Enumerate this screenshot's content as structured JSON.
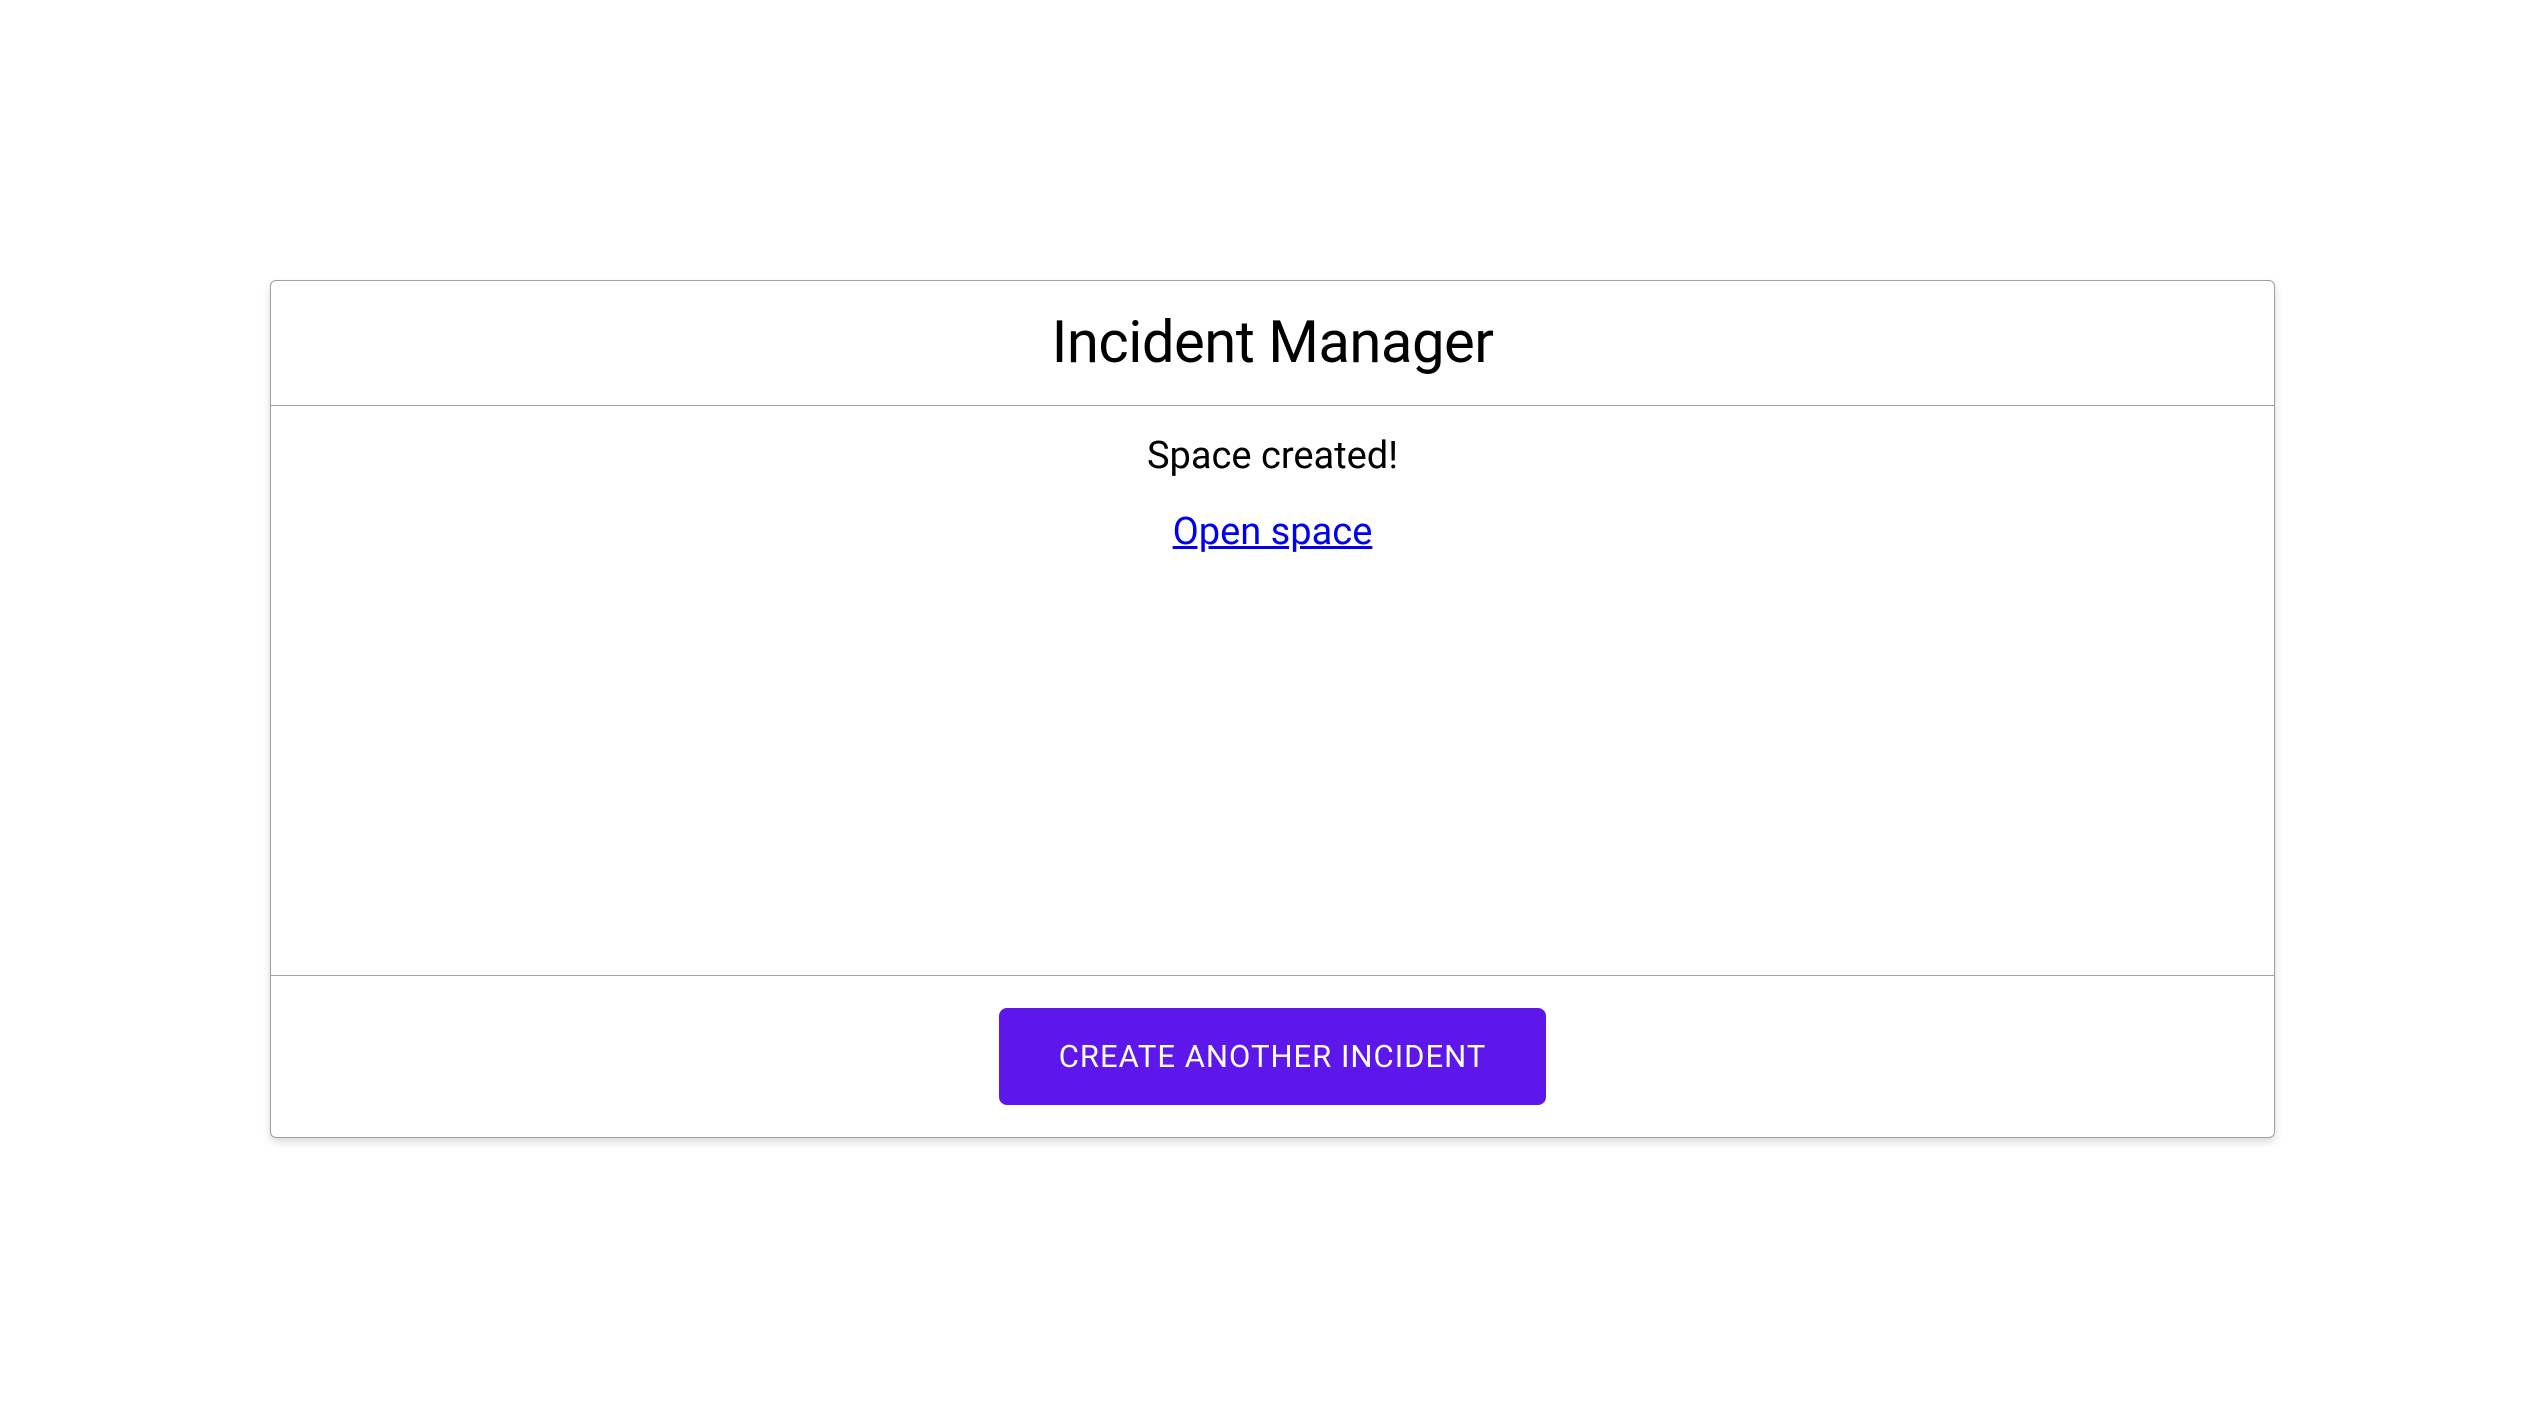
{
  "header": {
    "title": "Incident Manager"
  },
  "body": {
    "status_message": "Space created!",
    "link_label": "Open space"
  },
  "footer": {
    "button_label": "CREATE ANOTHER INCIDENT"
  },
  "colors": {
    "primary": "#5e17eb",
    "link": "#0000ee",
    "border": "#a0a0a0"
  }
}
